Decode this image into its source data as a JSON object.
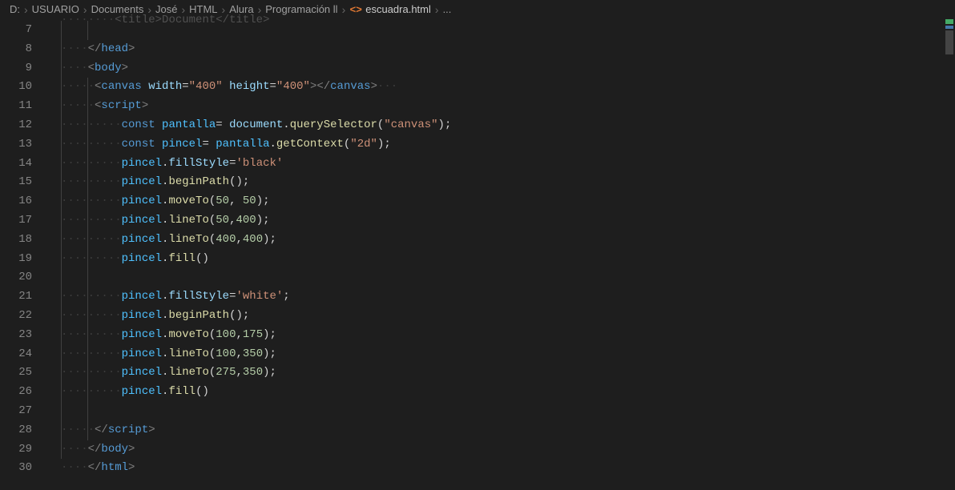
{
  "breadcrumb": {
    "segments": [
      "D:",
      "USUARIO",
      "Documents",
      "José",
      "HTML",
      "Alura",
      "Programación ll"
    ],
    "file": "escuadra.html",
    "tail": "..."
  },
  "lineStart": 7,
  "lines": [
    {
      "n": 7,
      "indent": 2,
      "tokens": [
        {
          "t": "        ",
          "c": "ws"
        },
        {
          "t": "<",
          "c": "dim"
        },
        {
          "t": "title",
          "c": "dim"
        },
        {
          "t": ">",
          "c": "dim"
        },
        {
          "t": "Document",
          "c": "dim"
        },
        {
          "t": "</",
          "c": "dim"
        },
        {
          "t": "title",
          "c": "dim"
        },
        {
          "t": ">",
          "c": "dim"
        }
      ],
      "cut": true
    },
    {
      "n": 8,
      "indent": 1,
      "tokens": [
        {
          "t": "    ",
          "c": "ws"
        },
        {
          "t": "</",
          "c": "gray"
        },
        {
          "t": "head",
          "c": "tag"
        },
        {
          "t": ">",
          "c": "gray"
        }
      ]
    },
    {
      "n": 9,
      "indent": 1,
      "tokens": [
        {
          "t": "    ",
          "c": "ws"
        },
        {
          "t": "<",
          "c": "gray"
        },
        {
          "t": "body",
          "c": "tag"
        },
        {
          "t": ">",
          "c": "gray"
        }
      ]
    },
    {
      "n": 10,
      "indent": 2,
      "tokens": [
        {
          "t": "     ",
          "c": "ws"
        },
        {
          "t": "<",
          "c": "gray"
        },
        {
          "t": "canvas",
          "c": "tag"
        },
        {
          "t": " ",
          "c": ""
        },
        {
          "t": "width",
          "c": "attr"
        },
        {
          "t": "=",
          "c": "pun"
        },
        {
          "t": "\"400\"",
          "c": "str"
        },
        {
          "t": " ",
          "c": ""
        },
        {
          "t": "height",
          "c": "attr"
        },
        {
          "t": "=",
          "c": "pun"
        },
        {
          "t": "\"400\"",
          "c": "str"
        },
        {
          "t": "></",
          "c": "gray"
        },
        {
          "t": "canvas",
          "c": "tag"
        },
        {
          "t": ">",
          "c": "gray"
        },
        {
          "t": "···",
          "c": "ws"
        }
      ]
    },
    {
      "n": 11,
      "indent": 2,
      "tokens": [
        {
          "t": "     ",
          "c": "ws"
        },
        {
          "t": "<",
          "c": "gray"
        },
        {
          "t": "script",
          "c": "tag"
        },
        {
          "t": ">",
          "c": "gray"
        }
      ]
    },
    {
      "n": 12,
      "indent": 2,
      "tokens": [
        {
          "t": "     ",
          "c": "ws"
        },
        {
          "t": "····",
          "c": "ws"
        },
        {
          "t": "const",
          "c": "kw"
        },
        {
          "t": " ",
          "c": ""
        },
        {
          "t": "pantalla",
          "c": "konst"
        },
        {
          "t": "=",
          "c": "pun"
        },
        {
          "t": " ",
          "c": ""
        },
        {
          "t": "document",
          "c": "var"
        },
        {
          "t": ".",
          "c": "pun"
        },
        {
          "t": "querySelector",
          "c": "fn"
        },
        {
          "t": "(",
          "c": "pun"
        },
        {
          "t": "\"canvas\"",
          "c": "str"
        },
        {
          "t": ");",
          "c": "pun"
        }
      ]
    },
    {
      "n": 13,
      "indent": 2,
      "tokens": [
        {
          "t": "     ",
          "c": "ws"
        },
        {
          "t": "····",
          "c": "ws"
        },
        {
          "t": "const",
          "c": "kw"
        },
        {
          "t": " ",
          "c": ""
        },
        {
          "t": "pincel",
          "c": "konst"
        },
        {
          "t": "=",
          "c": "pun"
        },
        {
          "t": " ",
          "c": ""
        },
        {
          "t": "pantalla",
          "c": "konst"
        },
        {
          "t": ".",
          "c": "pun"
        },
        {
          "t": "getContext",
          "c": "fn"
        },
        {
          "t": "(",
          "c": "pun"
        },
        {
          "t": "\"2d\"",
          "c": "str"
        },
        {
          "t": ");",
          "c": "pun"
        }
      ]
    },
    {
      "n": 14,
      "indent": 2,
      "tokens": [
        {
          "t": "     ",
          "c": "ws"
        },
        {
          "t": "····",
          "c": "ws"
        },
        {
          "t": "pincel",
          "c": "konst"
        },
        {
          "t": ".",
          "c": "pun"
        },
        {
          "t": "fillStyle",
          "c": "var"
        },
        {
          "t": "=",
          "c": "pun"
        },
        {
          "t": "'black'",
          "c": "str"
        }
      ]
    },
    {
      "n": 15,
      "indent": 2,
      "tokens": [
        {
          "t": "     ",
          "c": "ws"
        },
        {
          "t": "····",
          "c": "ws"
        },
        {
          "t": "pincel",
          "c": "konst"
        },
        {
          "t": ".",
          "c": "pun"
        },
        {
          "t": "beginPath",
          "c": "fn"
        },
        {
          "t": "();",
          "c": "pun"
        }
      ]
    },
    {
      "n": 16,
      "indent": 2,
      "tokens": [
        {
          "t": "     ",
          "c": "ws"
        },
        {
          "t": "····",
          "c": "ws"
        },
        {
          "t": "pincel",
          "c": "konst"
        },
        {
          "t": ".",
          "c": "pun"
        },
        {
          "t": "moveTo",
          "c": "fn"
        },
        {
          "t": "(",
          "c": "pun"
        },
        {
          "t": "50",
          "c": "num"
        },
        {
          "t": ",",
          "c": "pun"
        },
        {
          "t": " ",
          "c": ""
        },
        {
          "t": "50",
          "c": "num"
        },
        {
          "t": ");",
          "c": "pun"
        }
      ]
    },
    {
      "n": 17,
      "indent": 2,
      "tokens": [
        {
          "t": "     ",
          "c": "ws"
        },
        {
          "t": "····",
          "c": "ws"
        },
        {
          "t": "pincel",
          "c": "konst"
        },
        {
          "t": ".",
          "c": "pun"
        },
        {
          "t": "lineTo",
          "c": "fn"
        },
        {
          "t": "(",
          "c": "pun"
        },
        {
          "t": "50",
          "c": "num"
        },
        {
          "t": ",",
          "c": "pun"
        },
        {
          "t": "400",
          "c": "num"
        },
        {
          "t": ");",
          "c": "pun"
        }
      ]
    },
    {
      "n": 18,
      "indent": 2,
      "tokens": [
        {
          "t": "     ",
          "c": "ws"
        },
        {
          "t": "····",
          "c": "ws"
        },
        {
          "t": "pincel",
          "c": "konst"
        },
        {
          "t": ".",
          "c": "pun"
        },
        {
          "t": "lineTo",
          "c": "fn"
        },
        {
          "t": "(",
          "c": "pun"
        },
        {
          "t": "400",
          "c": "num"
        },
        {
          "t": ",",
          "c": "pun"
        },
        {
          "t": "400",
          "c": "num"
        },
        {
          "t": ");",
          "c": "pun"
        }
      ]
    },
    {
      "n": 19,
      "indent": 2,
      "tokens": [
        {
          "t": "     ",
          "c": "ws"
        },
        {
          "t": "····",
          "c": "ws"
        },
        {
          "t": "pincel",
          "c": "konst"
        },
        {
          "t": ".",
          "c": "pun"
        },
        {
          "t": "fill",
          "c": "fn"
        },
        {
          "t": "()",
          "c": "pun"
        }
      ]
    },
    {
      "n": 20,
      "indent": 2,
      "tokens": [
        {
          "t": "",
          "c": ""
        }
      ]
    },
    {
      "n": 21,
      "indent": 2,
      "tokens": [
        {
          "t": "     ",
          "c": "ws"
        },
        {
          "t": "····",
          "c": "ws"
        },
        {
          "t": "pincel",
          "c": "konst"
        },
        {
          "t": ".",
          "c": "pun"
        },
        {
          "t": "fillStyle",
          "c": "var"
        },
        {
          "t": "=",
          "c": "pun"
        },
        {
          "t": "'white'",
          "c": "str"
        },
        {
          "t": ";",
          "c": "pun"
        }
      ]
    },
    {
      "n": 22,
      "indent": 2,
      "tokens": [
        {
          "t": "     ",
          "c": "ws"
        },
        {
          "t": "····",
          "c": "ws"
        },
        {
          "t": "pincel",
          "c": "konst"
        },
        {
          "t": ".",
          "c": "pun"
        },
        {
          "t": "beginPath",
          "c": "fn"
        },
        {
          "t": "();",
          "c": "pun"
        }
      ]
    },
    {
      "n": 23,
      "indent": 2,
      "tokens": [
        {
          "t": "     ",
          "c": "ws"
        },
        {
          "t": "····",
          "c": "ws"
        },
        {
          "t": "pincel",
          "c": "konst"
        },
        {
          "t": ".",
          "c": "pun"
        },
        {
          "t": "moveTo",
          "c": "fn"
        },
        {
          "t": "(",
          "c": "pun"
        },
        {
          "t": "100",
          "c": "num"
        },
        {
          "t": ",",
          "c": "pun"
        },
        {
          "t": "175",
          "c": "num"
        },
        {
          "t": ");",
          "c": "pun"
        }
      ]
    },
    {
      "n": 24,
      "indent": 2,
      "tokens": [
        {
          "t": "     ",
          "c": "ws"
        },
        {
          "t": "····",
          "c": "ws"
        },
        {
          "t": "pincel",
          "c": "konst"
        },
        {
          "t": ".",
          "c": "pun"
        },
        {
          "t": "lineTo",
          "c": "fn"
        },
        {
          "t": "(",
          "c": "pun"
        },
        {
          "t": "100",
          "c": "num"
        },
        {
          "t": ",",
          "c": "pun"
        },
        {
          "t": "350",
          "c": "num"
        },
        {
          "t": ");",
          "c": "pun"
        }
      ]
    },
    {
      "n": 25,
      "indent": 2,
      "tokens": [
        {
          "t": "     ",
          "c": "ws"
        },
        {
          "t": "····",
          "c": "ws"
        },
        {
          "t": "pincel",
          "c": "konst"
        },
        {
          "t": ".",
          "c": "pun"
        },
        {
          "t": "lineTo",
          "c": "fn"
        },
        {
          "t": "(",
          "c": "pun"
        },
        {
          "t": "275",
          "c": "num"
        },
        {
          "t": ",",
          "c": "pun"
        },
        {
          "t": "350",
          "c": "num"
        },
        {
          "t": ");",
          "c": "pun"
        }
      ]
    },
    {
      "n": 26,
      "indent": 2,
      "tokens": [
        {
          "t": "     ",
          "c": "ws"
        },
        {
          "t": "····",
          "c": "ws"
        },
        {
          "t": "pincel",
          "c": "konst"
        },
        {
          "t": ".",
          "c": "pun"
        },
        {
          "t": "fill",
          "c": "fn"
        },
        {
          "t": "()",
          "c": "pun"
        }
      ]
    },
    {
      "n": 27,
      "indent": 2,
      "tokens": [
        {
          "t": "",
          "c": ""
        }
      ]
    },
    {
      "n": 28,
      "indent": 2,
      "tokens": [
        {
          "t": "     ",
          "c": "ws"
        },
        {
          "t": "</",
          "c": "gray"
        },
        {
          "t": "script",
          "c": "tag"
        },
        {
          "t": ">",
          "c": "gray"
        }
      ]
    },
    {
      "n": 29,
      "indent": 1,
      "tokens": [
        {
          "t": "    ",
          "c": "ws"
        },
        {
          "t": "</",
          "c": "gray"
        },
        {
          "t": "body",
          "c": "tag"
        },
        {
          "t": ">",
          "c": "gray"
        }
      ]
    },
    {
      "n": 30,
      "indent": 0,
      "tokens": [
        {
          "t": "    ",
          "c": "ws"
        },
        {
          "t": "</",
          "c": "gray"
        },
        {
          "t": "html",
          "c": "tag"
        },
        {
          "t": ">",
          "c": "gray"
        }
      ]
    }
  ]
}
